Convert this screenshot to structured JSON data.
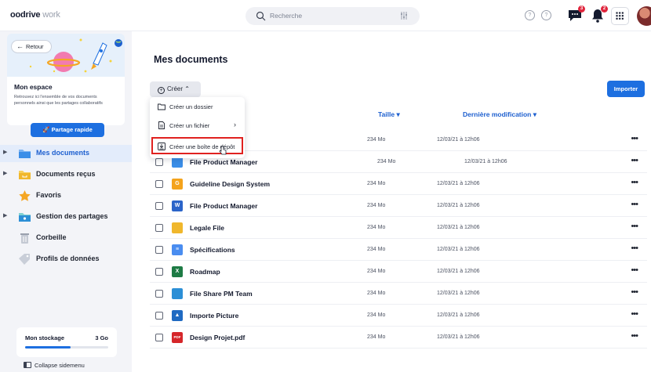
{
  "app": {
    "logo_main": "oodrive",
    "logo_sub": "work"
  },
  "topbar": {
    "search_placeholder": "Recherche",
    "help1": "?",
    "help2": "?",
    "chat_badge": "3",
    "bell_badge": "2"
  },
  "sidebar": {
    "back_label": "Retour",
    "space_title": "Mon espace",
    "space_desc": "Retrouvez ici l'ensemble de vos documents personnels ainsi que les partages collaboratifs",
    "share_label": "Partage rapide",
    "items": [
      {
        "label": "Mes documents",
        "icon": "folder-icon",
        "caret": true,
        "active": true
      },
      {
        "label": "Documents reçus",
        "icon": "folder-inbox-icon",
        "caret": true,
        "active": false
      },
      {
        "label": "Favoris",
        "icon": "star-icon",
        "caret": false,
        "active": false
      },
      {
        "label": "Gestion des partages",
        "icon": "shared-folder-icon",
        "caret": true,
        "active": false
      },
      {
        "label": "Corbeille",
        "icon": "trash-icon",
        "caret": false,
        "active": false
      },
      {
        "label": "Profils de données",
        "icon": "tag-icon",
        "caret": false,
        "active": false
      }
    ],
    "storage_label": "Mon stockage",
    "storage_value": "3 Go",
    "storage_fill": 0.55,
    "collapse_label": "Collapse sidemenu"
  },
  "main": {
    "title": "Mes documents",
    "create_label": "Créer",
    "import_label": "Importer",
    "col_size": "Taille",
    "col_modified": "Dernière modification",
    "dropdown": [
      {
        "label": "Créer un dossier",
        "icon": "folder-outline-icon",
        "chevron": false
      },
      {
        "label": "Créer un fichier",
        "icon": "file-outline-icon",
        "chevron": true
      },
      {
        "label": "Créer une boîte de dépôt",
        "icon": "dropbox-outline-icon",
        "chevron": false
      }
    ],
    "rows": [
      {
        "name": "",
        "size": "234 Mo",
        "date": "12/03/21 à 12h06",
        "icon": "folder-icon",
        "color": "#3b8ee8",
        "glyph": "",
        "hidden_name": true
      },
      {
        "name": "File Product Manager",
        "size": "234 Mo",
        "date": "12/03/21 à 12h06",
        "icon": "folder-icon",
        "color": "#3b8ee8",
        "glyph": "",
        "shift": true
      },
      {
        "name": "Guideline Design System",
        "size": "234 Mo",
        "date": "12/03/21 à 12h06",
        "icon": "slides-icon",
        "color": "#f4a31c",
        "glyph": "G"
      },
      {
        "name": "File Product Manager",
        "size": "234 Mo",
        "date": "12/03/21 à 12h06",
        "icon": "word-icon",
        "color": "#2b64c9",
        "glyph": "W"
      },
      {
        "name": "Legale File",
        "size": "234 Mo",
        "date": "12/03/21 à 12h06",
        "icon": "folder-yellow-icon",
        "color": "#f0b72c",
        "glyph": ""
      },
      {
        "name": "Spécifications",
        "size": "234 Mo",
        "date": "12/03/21 à 12h06",
        "icon": "doc-icon",
        "color": "#4a8df0",
        "glyph": "≡"
      },
      {
        "name": "Roadmap",
        "size": "234 Mo",
        "date": "12/03/21 à 12h06",
        "icon": "excel-icon",
        "color": "#1e7b45",
        "glyph": "X"
      },
      {
        "name": "File Share PM Team",
        "size": "234 Mo",
        "date": "12/03/21 à 12h06",
        "icon": "shared-folder-icon",
        "color": "#2c8fd6",
        "glyph": ""
      },
      {
        "name": "Importe Picture",
        "size": "234 Mo",
        "date": "12/03/21 à 12h06",
        "icon": "image-icon",
        "color": "#1f6ac2",
        "glyph": "▲"
      },
      {
        "name": "Design Projet.pdf",
        "size": "234 Mo",
        "date": "12/03/21 à 12h06",
        "icon": "pdf-icon",
        "color": "#d5262a",
        "glyph": "PDF"
      }
    ]
  }
}
